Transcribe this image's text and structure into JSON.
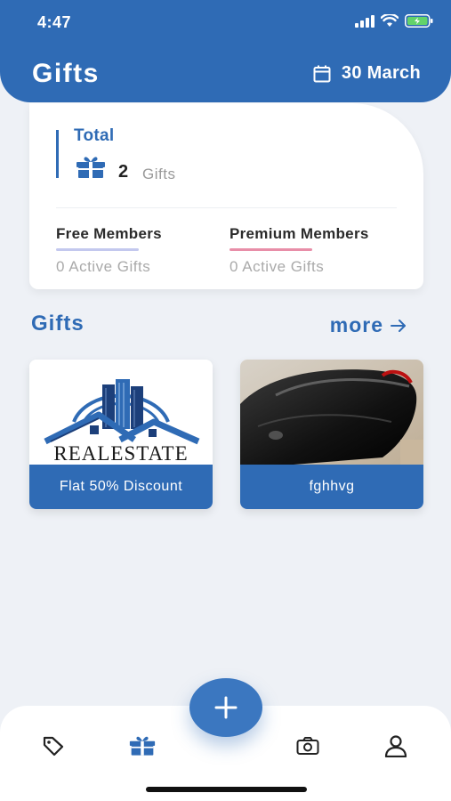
{
  "status_bar": {
    "time": "4:47"
  },
  "header": {
    "title": "Gifts",
    "date": "30 March"
  },
  "summary": {
    "total_label": "Total",
    "total_count": "2",
    "total_unit": "Gifts",
    "free": {
      "label": "Free Members",
      "value": "0 Active Gifts"
    },
    "premium": {
      "label": "Premium Members",
      "value": "0 Active Gifts"
    }
  },
  "gifts_section": {
    "title": "Gifts",
    "more_label": "more",
    "items": [
      {
        "caption": "Flat 50% Discount",
        "logo_text": "REALESTATE"
      },
      {
        "caption": "fghhvg"
      }
    ]
  },
  "nav": {
    "items": [
      "tag-icon",
      "gift-icon",
      "add-icon",
      "camera-icon",
      "profile-icon"
    ],
    "active": "gift-icon"
  },
  "colors": {
    "primary": "#2f6bb5",
    "background": "#eef1f6",
    "free_accent": "#c3c8ee",
    "premium_accent": "#e88ea8"
  }
}
